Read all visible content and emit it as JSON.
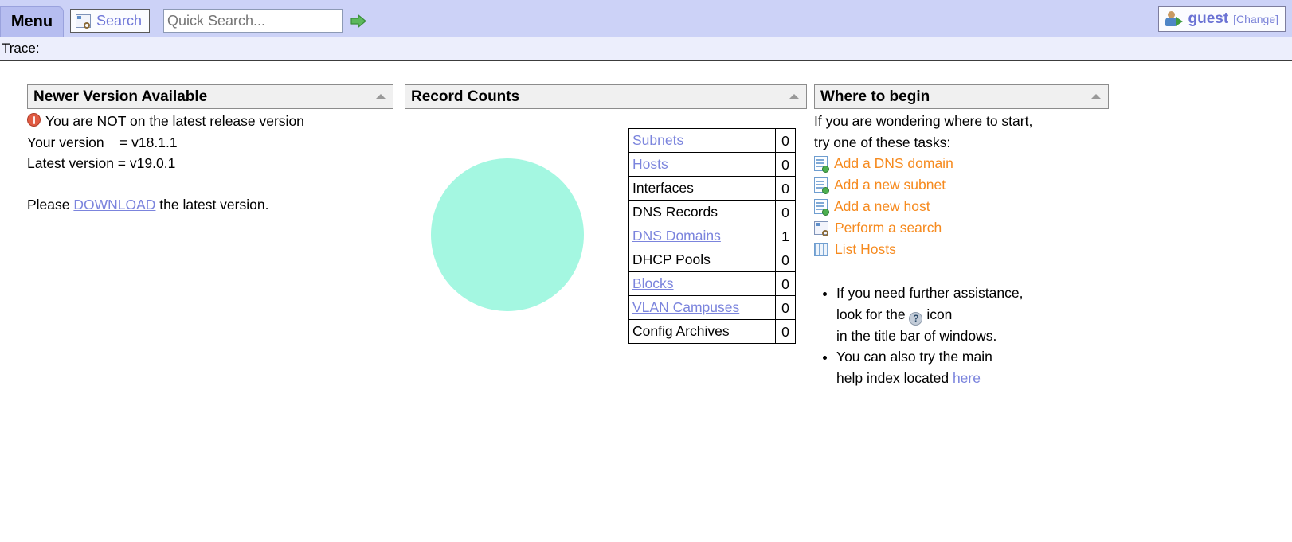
{
  "topbar": {
    "menu_label": "Menu",
    "search_button_label": "Search",
    "search_icon": "search-window-icon",
    "quick_search_placeholder": "Quick Search...",
    "quick_search_value": "",
    "go_icon": "green-right-arrow-icon",
    "user": {
      "name": "guest",
      "change_label": "[Change]",
      "avatar_icon": "user-avatar-icon"
    }
  },
  "trace": {
    "label": "Trace:"
  },
  "panels": {
    "version": {
      "title": "Newer Version Available",
      "collapse_icon": "collapse-triangle-icon",
      "warning_icon": "warning-icon",
      "warning_text": "You are NOT on the latest release version",
      "your_version": "Your version    = v18.1.1",
      "latest_version": "Latest version = v19.0.1",
      "download_prefix": "Please ",
      "download_link": "DOWNLOAD",
      "download_suffix": " the latest version."
    },
    "records": {
      "title": "Record Counts",
      "collapse_icon": "collapse-triangle-icon",
      "rows": [
        {
          "label": "Subnets",
          "value": "0",
          "link": true
        },
        {
          "label": "Hosts",
          "value": "0",
          "link": true
        },
        {
          "label": "Interfaces",
          "value": "0",
          "link": false
        },
        {
          "label": "DNS Records",
          "value": "0",
          "link": false
        },
        {
          "label": "DNS Domains",
          "value": "1",
          "link": true
        },
        {
          "label": "DHCP Pools",
          "value": "0",
          "link": false
        },
        {
          "label": "Blocks",
          "value": "0",
          "link": true
        },
        {
          "label": "VLAN Campuses",
          "value": "0",
          "link": true
        },
        {
          "label": "Config Archives",
          "value": "0",
          "link": false
        }
      ]
    },
    "begin": {
      "title": "Where to begin",
      "collapse_icon": "collapse-triangle-icon",
      "intro_line1": "If you are wondering where to start,",
      "intro_line2": "try one of these tasks:",
      "tasks": [
        {
          "label": "Add a DNS domain",
          "icon": "document-add-icon"
        },
        {
          "label": "Add a new subnet",
          "icon": "document-add-icon"
        },
        {
          "label": "Add a new host",
          "icon": "document-add-icon"
        },
        {
          "label": "Perform a search",
          "icon": "search-window-icon"
        },
        {
          "label": "List Hosts",
          "icon": "grid-table-icon"
        }
      ],
      "tips": {
        "tip1_part1": "If you need further assistance,",
        "tip1_part2": "look for the ",
        "tip1_icon": "help-question-icon",
        "tip1_part3": " icon",
        "tip1_part4": "in the title bar of windows.",
        "tip2_part1": "You can also try the main",
        "tip2_part2": "help index located ",
        "tip2_link": "here"
      }
    }
  },
  "chart_data": {
    "type": "pie",
    "title": "Record Counts",
    "categories": [
      "DNS Domains"
    ],
    "values": [
      1
    ],
    "colors": [
      "#a4f7e1"
    ],
    "legend": "none",
    "total": 1
  },
  "colors": {
    "topbar_bg": "#ccd2f7",
    "menu_tab_bg": "#b6bdf0",
    "link": "#7b84dd",
    "task_link": "#f68a1e",
    "pie_slice": "#a4f7e1",
    "warning": "#e05b42",
    "panel_head_bg": "#f0f0f0"
  }
}
